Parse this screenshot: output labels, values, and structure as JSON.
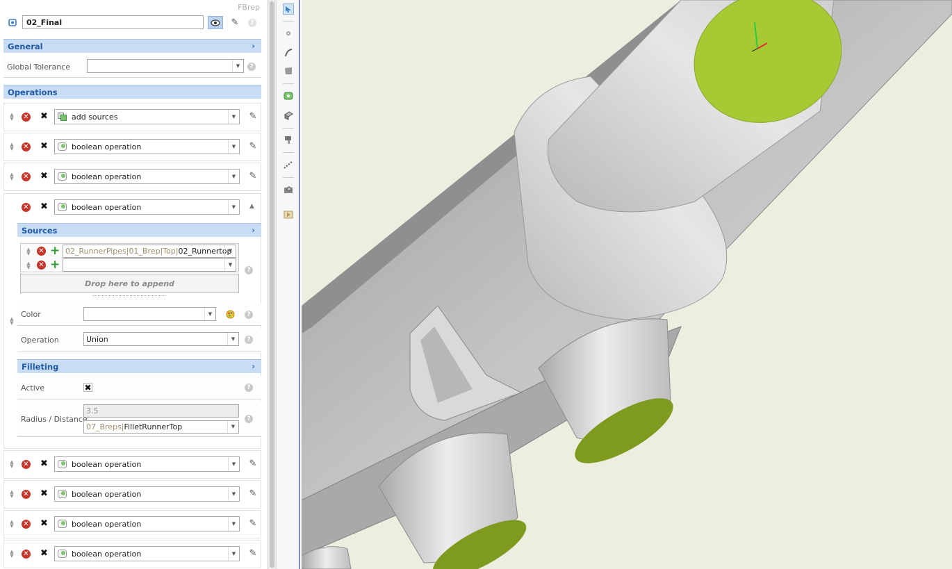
{
  "panel": {
    "type_tag": "FBrep",
    "name_value": "02_Final",
    "general": {
      "title": "General",
      "global_tolerance_label": "Global Tolerance",
      "global_tolerance_value": ""
    },
    "operations": {
      "title": "Operations",
      "items_before": [
        {
          "label": "add sources"
        },
        {
          "label": "boolean operation"
        },
        {
          "label": "boolean operation"
        }
      ],
      "expanded": {
        "label": "boolean operation",
        "sources": {
          "title": "Sources",
          "rows": [
            {
              "prefix": "02_RunnerPipes|01_Brep|Top|",
              "value": "02_Runnertop"
            },
            {
              "prefix": "",
              "value": ""
            }
          ],
          "drop_text": "Drop here to append"
        },
        "color_label": "Color",
        "color_value": "",
        "operation_label": "Operation",
        "operation_value": "Union",
        "filleting": {
          "title": "Filleting",
          "active_label": "Active",
          "radius_label": "Radius / Distance",
          "radius_value": "3.5",
          "radius_ref_prefix": "07_Breps|",
          "radius_ref_value": "FilletRunnerTop"
        }
      },
      "items_after": [
        {
          "label": "boolean operation"
        },
        {
          "label": "boolean operation"
        },
        {
          "label": "boolean operation"
        },
        {
          "label": "boolean operation"
        }
      ]
    }
  },
  "toolbar": {
    "icons": [
      "select-icon",
      "point-icon",
      "curve-icon",
      "surface-icon",
      "brep-icon",
      "solid-icon",
      "measure-icon",
      "dashed-line-icon",
      "camera-icon",
      "play-icon"
    ]
  },
  "viewport": {
    "background": "#eeeee0",
    "face_color": "#a6c934",
    "model_color": "#c9c9c9"
  }
}
